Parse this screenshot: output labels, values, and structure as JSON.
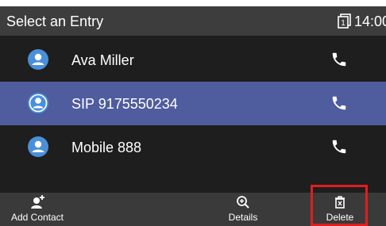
{
  "header": {
    "title": "Select an Entry",
    "line_icon": "line-icon",
    "time": "14:00"
  },
  "entries": [
    {
      "name": "Ava Miller",
      "avatar_icon": "contact-avatar-icon",
      "action_icon": "phone-icon",
      "selected": false
    },
    {
      "name": "SIP 9175550234",
      "avatar_icon": "contact-avatar-icon",
      "action_icon": "phone-icon",
      "selected": true
    },
    {
      "name": "Mobile 888",
      "avatar_icon": "contact-avatar-icon",
      "action_icon": "phone-icon",
      "selected": false
    }
  ],
  "toolbar": {
    "add_contact_label": "Add Contact",
    "details_label": "Details",
    "delete_label": "Delete"
  },
  "colors": {
    "header_bg": "#3d3d3d",
    "list_bg": "#1e1e1e",
    "selected_row": "#4f5c9e",
    "avatar": "#4a90d9",
    "highlight_box": "#e01e1e"
  }
}
